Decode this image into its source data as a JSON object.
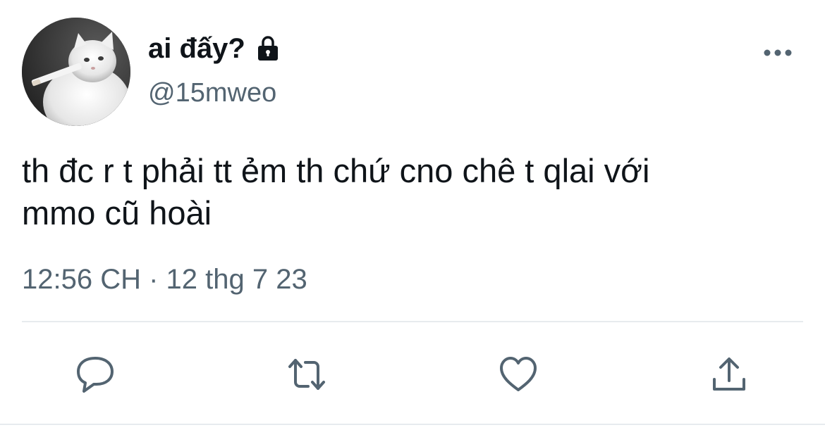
{
  "tweet": {
    "author": {
      "display_name": "ai đấy?",
      "handle": "@15mweo",
      "protected_icon": "lock-icon",
      "avatar": "white-kitten-avatar"
    },
    "text": "th đc r t phải tt ẻm th chứ cno chê t qlai với\nmmo cũ hoài",
    "time": "12:56 CH",
    "separator": " · ",
    "date": "12 thg 7 23"
  },
  "actions": [
    {
      "name": "reply",
      "icon": "reply-icon"
    },
    {
      "name": "retweet",
      "icon": "retweet-icon"
    },
    {
      "name": "like",
      "icon": "heart-icon"
    },
    {
      "name": "share",
      "icon": "share-icon"
    }
  ],
  "more_icon": "more-icon",
  "colors": {
    "text": "#0f1419",
    "secondary": "#536471",
    "divider": "#e7ebee",
    "icon": "#536471"
  }
}
